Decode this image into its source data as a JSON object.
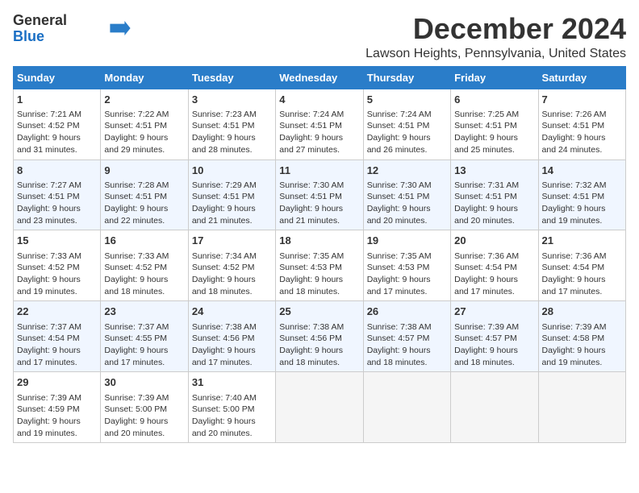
{
  "logo": {
    "line1": "General",
    "line2": "Blue",
    "arrow_color": "#2a7dc9"
  },
  "title": "December 2024",
  "subtitle": "Lawson Heights, Pennsylvania, United States",
  "days_of_week": [
    "Sunday",
    "Monday",
    "Tuesday",
    "Wednesday",
    "Thursday",
    "Friday",
    "Saturday"
  ],
  "weeks": [
    [
      {
        "day": "1",
        "lines": [
          "Sunrise: 7:21 AM",
          "Sunset: 4:52 PM",
          "Daylight: 9 hours",
          "and 31 minutes."
        ]
      },
      {
        "day": "2",
        "lines": [
          "Sunrise: 7:22 AM",
          "Sunset: 4:51 PM",
          "Daylight: 9 hours",
          "and 29 minutes."
        ]
      },
      {
        "day": "3",
        "lines": [
          "Sunrise: 7:23 AM",
          "Sunset: 4:51 PM",
          "Daylight: 9 hours",
          "and 28 minutes."
        ]
      },
      {
        "day": "4",
        "lines": [
          "Sunrise: 7:24 AM",
          "Sunset: 4:51 PM",
          "Daylight: 9 hours",
          "and 27 minutes."
        ]
      },
      {
        "day": "5",
        "lines": [
          "Sunrise: 7:24 AM",
          "Sunset: 4:51 PM",
          "Daylight: 9 hours",
          "and 26 minutes."
        ]
      },
      {
        "day": "6",
        "lines": [
          "Sunrise: 7:25 AM",
          "Sunset: 4:51 PM",
          "Daylight: 9 hours",
          "and 25 minutes."
        ]
      },
      {
        "day": "7",
        "lines": [
          "Sunrise: 7:26 AM",
          "Sunset: 4:51 PM",
          "Daylight: 9 hours",
          "and 24 minutes."
        ]
      }
    ],
    [
      {
        "day": "8",
        "lines": [
          "Sunrise: 7:27 AM",
          "Sunset: 4:51 PM",
          "Daylight: 9 hours",
          "and 23 minutes."
        ]
      },
      {
        "day": "9",
        "lines": [
          "Sunrise: 7:28 AM",
          "Sunset: 4:51 PM",
          "Daylight: 9 hours",
          "and 22 minutes."
        ]
      },
      {
        "day": "10",
        "lines": [
          "Sunrise: 7:29 AM",
          "Sunset: 4:51 PM",
          "Daylight: 9 hours",
          "and 21 minutes."
        ]
      },
      {
        "day": "11",
        "lines": [
          "Sunrise: 7:30 AM",
          "Sunset: 4:51 PM",
          "Daylight: 9 hours",
          "and 21 minutes."
        ]
      },
      {
        "day": "12",
        "lines": [
          "Sunrise: 7:30 AM",
          "Sunset: 4:51 PM",
          "Daylight: 9 hours",
          "and 20 minutes."
        ]
      },
      {
        "day": "13",
        "lines": [
          "Sunrise: 7:31 AM",
          "Sunset: 4:51 PM",
          "Daylight: 9 hours",
          "and 20 minutes."
        ]
      },
      {
        "day": "14",
        "lines": [
          "Sunrise: 7:32 AM",
          "Sunset: 4:51 PM",
          "Daylight: 9 hours",
          "and 19 minutes."
        ]
      }
    ],
    [
      {
        "day": "15",
        "lines": [
          "Sunrise: 7:33 AM",
          "Sunset: 4:52 PM",
          "Daylight: 9 hours",
          "and 19 minutes."
        ]
      },
      {
        "day": "16",
        "lines": [
          "Sunrise: 7:33 AM",
          "Sunset: 4:52 PM",
          "Daylight: 9 hours",
          "and 18 minutes."
        ]
      },
      {
        "day": "17",
        "lines": [
          "Sunrise: 7:34 AM",
          "Sunset: 4:52 PM",
          "Daylight: 9 hours",
          "and 18 minutes."
        ]
      },
      {
        "day": "18",
        "lines": [
          "Sunrise: 7:35 AM",
          "Sunset: 4:53 PM",
          "Daylight: 9 hours",
          "and 18 minutes."
        ]
      },
      {
        "day": "19",
        "lines": [
          "Sunrise: 7:35 AM",
          "Sunset: 4:53 PM",
          "Daylight: 9 hours",
          "and 17 minutes."
        ]
      },
      {
        "day": "20",
        "lines": [
          "Sunrise: 7:36 AM",
          "Sunset: 4:54 PM",
          "Daylight: 9 hours",
          "and 17 minutes."
        ]
      },
      {
        "day": "21",
        "lines": [
          "Sunrise: 7:36 AM",
          "Sunset: 4:54 PM",
          "Daylight: 9 hours",
          "and 17 minutes."
        ]
      }
    ],
    [
      {
        "day": "22",
        "lines": [
          "Sunrise: 7:37 AM",
          "Sunset: 4:54 PM",
          "Daylight: 9 hours",
          "and 17 minutes."
        ]
      },
      {
        "day": "23",
        "lines": [
          "Sunrise: 7:37 AM",
          "Sunset: 4:55 PM",
          "Daylight: 9 hours",
          "and 17 minutes."
        ]
      },
      {
        "day": "24",
        "lines": [
          "Sunrise: 7:38 AM",
          "Sunset: 4:56 PM",
          "Daylight: 9 hours",
          "and 17 minutes."
        ]
      },
      {
        "day": "25",
        "lines": [
          "Sunrise: 7:38 AM",
          "Sunset: 4:56 PM",
          "Daylight: 9 hours",
          "and 18 minutes."
        ]
      },
      {
        "day": "26",
        "lines": [
          "Sunrise: 7:38 AM",
          "Sunset: 4:57 PM",
          "Daylight: 9 hours",
          "and 18 minutes."
        ]
      },
      {
        "day": "27",
        "lines": [
          "Sunrise: 7:39 AM",
          "Sunset: 4:57 PM",
          "Daylight: 9 hours",
          "and 18 minutes."
        ]
      },
      {
        "day": "28",
        "lines": [
          "Sunrise: 7:39 AM",
          "Sunset: 4:58 PM",
          "Daylight: 9 hours",
          "and 19 minutes."
        ]
      }
    ],
    [
      {
        "day": "29",
        "lines": [
          "Sunrise: 7:39 AM",
          "Sunset: 4:59 PM",
          "Daylight: 9 hours",
          "and 19 minutes."
        ]
      },
      {
        "day": "30",
        "lines": [
          "Sunrise: 7:39 AM",
          "Sunset: 5:00 PM",
          "Daylight: 9 hours",
          "and 20 minutes."
        ]
      },
      {
        "day": "31",
        "lines": [
          "Sunrise: 7:40 AM",
          "Sunset: 5:00 PM",
          "Daylight: 9 hours",
          "and 20 minutes."
        ]
      },
      {
        "day": "",
        "lines": []
      },
      {
        "day": "",
        "lines": []
      },
      {
        "day": "",
        "lines": []
      },
      {
        "day": "",
        "lines": []
      }
    ]
  ]
}
